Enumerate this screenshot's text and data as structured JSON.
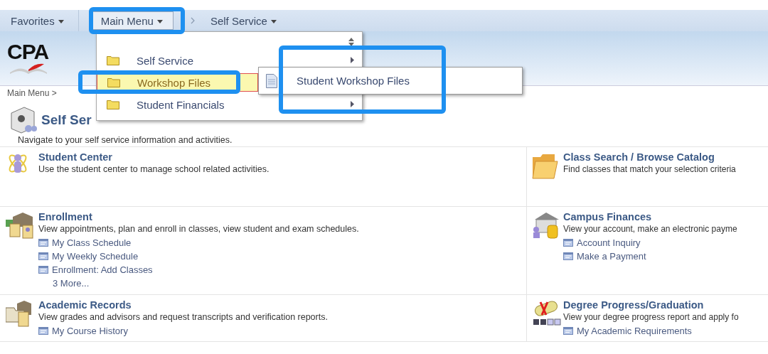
{
  "nav": {
    "items": [
      {
        "label": "Favorites",
        "kind": "dropdown"
      },
      {
        "label": "Main Menu",
        "kind": "button"
      },
      {
        "label": "Self Service",
        "kind": "crumb"
      }
    ]
  },
  "header": {
    "logo": "CPA"
  },
  "menu": {
    "items": [
      {
        "label": "Self Service",
        "arrow": true,
        "selected": false
      },
      {
        "label": "Workshop Files",
        "arrow": false,
        "selected": true
      },
      {
        "label": "Student Financials",
        "arrow": true,
        "selected": false
      }
    ]
  },
  "submenu": {
    "items": [
      {
        "label": "Student Workshop Files"
      }
    ]
  },
  "highlights": [
    {
      "kind": "nav"
    },
    {
      "kind": "menu_item"
    },
    {
      "kind": "submenu"
    }
  ],
  "breadcrumb": "Main Menu >",
  "page": {
    "title": "Self Ser",
    "description": "Navigate to your self service information and activities."
  },
  "tiles": [
    {
      "title": "Student Center",
      "description": "Use the student center to manage school related activities."
    },
    {
      "title": "Class Search / Browse Catalog",
      "description": "Find classes that match your selection criteria"
    },
    {
      "title": "Enrollment",
      "description": "View appointments, plan and enroll in classes, view student and exam schedules.",
      "links": [
        "My Class Schedule",
        "My Weekly Schedule",
        "Enrollment: Add Classes"
      ],
      "more": "3 More..."
    },
    {
      "title": "Campus Finances",
      "description": "View your account, make an electronic payme",
      "links": [
        "Account Inquiry",
        "Make a Payment"
      ]
    },
    {
      "title": "Academic Records",
      "description": "View grades and advisors and request transcripts and verification reports.",
      "links": [
        "My Course History"
      ]
    },
    {
      "title": "Degree Progress/Graduation",
      "description": "View your degree progress report and apply fo",
      "links": [
        "My Academic Requirements"
      ]
    }
  ]
}
